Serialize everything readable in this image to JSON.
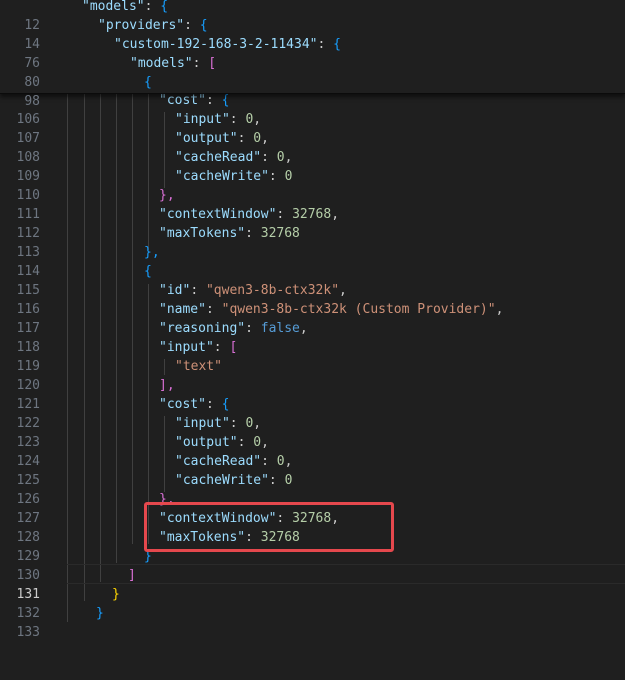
{
  "editor": {
    "sticky_lines": [
      {
        "num": "12",
        "text": "\"models\": {"
      },
      {
        "num": "14",
        "text": "\"providers\": {"
      },
      {
        "num": "76",
        "text": "\"custom-192-168-3-2-11434\": {"
      },
      {
        "num": "80",
        "text": "\"models\": ["
      },
      {
        "num": "98",
        "text": "{"
      }
    ],
    "lines": [
      {
        "num": "106",
        "text": "\"cost\": {"
      },
      {
        "num": "107",
        "text": "\"input\": 0,"
      },
      {
        "num": "108",
        "text": "\"output\": 0,"
      },
      {
        "num": "109",
        "text": "\"cacheRead\": 0,"
      },
      {
        "num": "110",
        "text": "\"cacheWrite\": 0"
      },
      {
        "num": "111",
        "text": "},"
      },
      {
        "num": "112",
        "text": "\"contextWindow\": 32768,"
      },
      {
        "num": "113",
        "text": "\"maxTokens\": 32768"
      },
      {
        "num": "114",
        "text": "},"
      },
      {
        "num": "115",
        "text": "{"
      },
      {
        "num": "116",
        "text": "\"id\": \"qwen3-8b-ctx32k\","
      },
      {
        "num": "117",
        "text": "\"name\": \"qwen3-8b-ctx32k (Custom Provider)\","
      },
      {
        "num": "118",
        "text": "\"reasoning\": false,"
      },
      {
        "num": "119",
        "text": "\"input\": ["
      },
      {
        "num": "120",
        "text": "\"text\""
      },
      {
        "num": "121",
        "text": "],"
      },
      {
        "num": "122",
        "text": "\"cost\": {"
      },
      {
        "num": "123",
        "text": "\"input\": 0,"
      },
      {
        "num": "124",
        "text": "\"output\": 0,"
      },
      {
        "num": "125",
        "text": "\"cacheRead\": 0,"
      },
      {
        "num": "126",
        "text": "\"cacheWrite\": 0"
      },
      {
        "num": "127",
        "text": "},"
      },
      {
        "num": "128",
        "text": "\"contextWindow\": 32768,"
      },
      {
        "num": "129",
        "text": "\"maxTokens\": 32768"
      },
      {
        "num": "130",
        "text": "}"
      },
      {
        "num": "131",
        "text": "]"
      },
      {
        "num": "132",
        "text": "}"
      },
      {
        "num": "133",
        "text": "}"
      }
    ],
    "active_line": "131"
  },
  "colors": {
    "background": "#1f1f1f",
    "highlight_box": "#e5484d",
    "key": "#9cdcfe",
    "string": "#ce9178",
    "number": "#b5cea8",
    "keyword": "#569cd6"
  }
}
